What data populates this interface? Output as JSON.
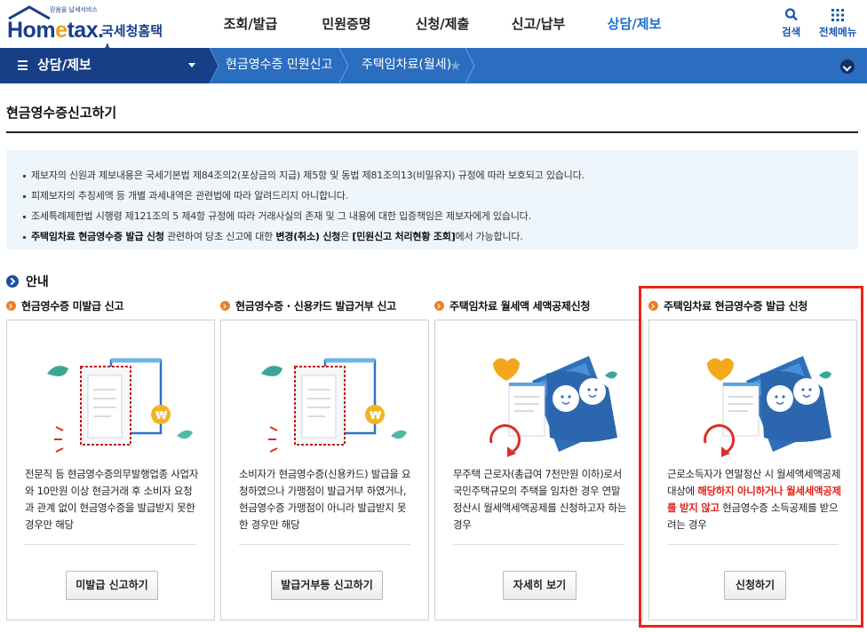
{
  "header": {
    "logo": {
      "small_text": "믿음을 납세서비스",
      "wordmark": "Hometax",
      "brand_kr": "국세청홈택스"
    },
    "nav": [
      {
        "label": "조회/발급",
        "active": false
      },
      {
        "label": "민원증명",
        "active": false
      },
      {
        "label": "신청/제출",
        "active": false
      },
      {
        "label": "신고/납부",
        "active": false
      },
      {
        "label": "상담/제보",
        "active": true
      }
    ],
    "search_label": "검색",
    "menu_label": "전체메뉴"
  },
  "location": {
    "section": "상담/제보",
    "crumbs": [
      "현금영수증 민원신고",
      "주택임차료(월세)"
    ]
  },
  "page": {
    "title": "현금영수증신고하기"
  },
  "notice": {
    "items": [
      "제보자의 신원과 제보내용은 국세기본법 제84조의2(포상금의 지급) 제5항 및 동법 제81조의13(비밀유지) 규정에 따라 보호되고 있습니다.",
      "피제보자의 추징세액 등 개별 과세내역은 관련법에 따라 알려드리지 아니합니다.",
      "조세특례제한법 시행령 제121조의 5 제4항 규정에 따라 거래사실의 존재 및 그 내용에 대한 입증책임은 제보자에게 있습니다."
    ],
    "last": {
      "b1": "주택임차료 현금영수증 발급 신청",
      "t1": " 관련하여 당초 신고에 대한 ",
      "b2": "변경(취소) 신청",
      "t2": "은 ",
      "b3": "[민원신고 처리현황 조회]",
      "t3": "에서 가능합니다."
    }
  },
  "guide": {
    "label": "안내",
    "cards": [
      {
        "title": "현금영수증 미발급 신고",
        "desc": "전문직 등 현금영수증의무발행업종 사업자와 10만원 이상 현금거래 후 소비자 요청과 관계 없이 현금영수증을 발급받지 못한 경우만 해당",
        "button": "미발급 신고하기"
      },
      {
        "title": "현금영수증 · 신용카드 발급거부 신고",
        "desc": "소비자가 현금영수증(신용카드) 발급을 요청하였으나 가맹점이 발급거부 하였거나, 현금영수증 가맹점이 아니라 발급받지 못한 경우만 해당",
        "button": "발급거부등 신고하기"
      },
      {
        "title": "주택임차료 월세액 세액공제신청",
        "desc": "무주택 근로자(총급여 7천만원 이하)로서 국민주택규모의 주택을 임차한 경우 연말정산시 월세액세액공제를 신청하고자 하는 경우",
        "button": "자세히 보기"
      },
      {
        "title": "주택임차료 현금영수증 발급 신청",
        "desc_pre": "근로소득자가 연말정산 시 월세액세액공제 대상에 ",
        "desc_red": "해당하지 아니하거나 월세세액공제를 받지 않고",
        "desc_post": " 현금영수증 소득공제를 받으려는 경우",
        "button": "신청하기"
      }
    ]
  },
  "colors": {
    "brand_navy": "#173f86",
    "bar_blue": "#2b6dbf",
    "active_nav": "#1c6fd0",
    "bullet_orange": "#ef7e22",
    "highlight_red": "#e8261c",
    "notice_bg": "#eef5fb"
  }
}
